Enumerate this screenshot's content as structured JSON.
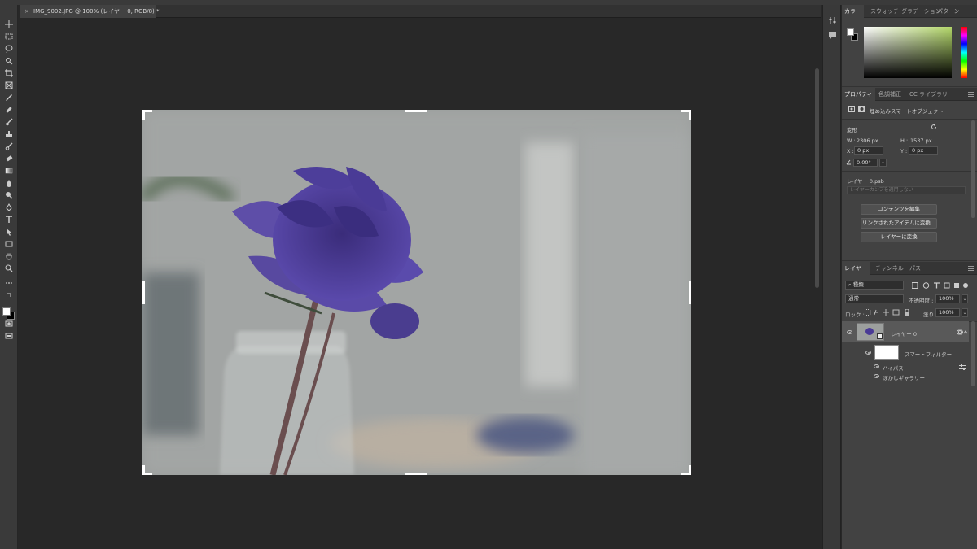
{
  "document": {
    "tab_title": "IMG_9002.JPG @ 100% (レイヤー 0, RGB/8) *",
    "close_glyph": "×"
  },
  "toolbar": {
    "tools": [
      "move-icon",
      "marquee-icon",
      "lasso-icon",
      "quick-select-icon",
      "crop-icon",
      "frame-icon",
      "eyedropper-icon",
      "healing-icon",
      "brush-icon",
      "stamp-icon",
      "history-brush-icon",
      "eraser-icon",
      "gradient-icon",
      "blur-icon",
      "dodge-icon",
      "pen-icon",
      "type-icon",
      "path-select-icon",
      "rectangle-icon",
      "hand-icon",
      "zoom-icon",
      "more-icon"
    ]
  },
  "color_panel": {
    "tabs": [
      "カラー",
      "スウォッチ",
      "グラデーション",
      "パターン"
    ],
    "active_tab": "カラー",
    "accent": "#b4d86a"
  },
  "properties_panel": {
    "tabs": [
      "プロパティ",
      "色調補正",
      "CC ライブラリ"
    ],
    "object_type": "埋め込みスマートオブジェクト",
    "transform_label": "変形",
    "w_label": "W :",
    "w_value": "2306 px",
    "h_label": "H :",
    "h_value": "1537 px",
    "x_label": "X :",
    "x_value": "0 px",
    "y_label": "Y :",
    "y_value": "0 px",
    "angle_value": "0.00°",
    "layer_source": "レイヤー 0.psb",
    "comp_placeholder": "レイヤーカンプを適用しない",
    "buttons": [
      "コンテンツを編集",
      "リンクされたアイテムに変換...",
      "レイヤーに変換"
    ]
  },
  "layers_panel": {
    "tabs": [
      "レイヤー",
      "チャンネル",
      "パス"
    ],
    "filter_kind": "種類",
    "blend_mode": "通常",
    "opacity_label": "不透明度 :",
    "opacity_value": "100%",
    "lock_label": "ロック :",
    "fill_label": "塗り :",
    "fill_value": "100%",
    "layers": [
      {
        "name": "レイヤー 0",
        "selected": true
      },
      {
        "name": "スマートフィルター"
      },
      {
        "name": "ハイパス"
      },
      {
        "name": "ぼかしギャラリー"
      }
    ]
  }
}
